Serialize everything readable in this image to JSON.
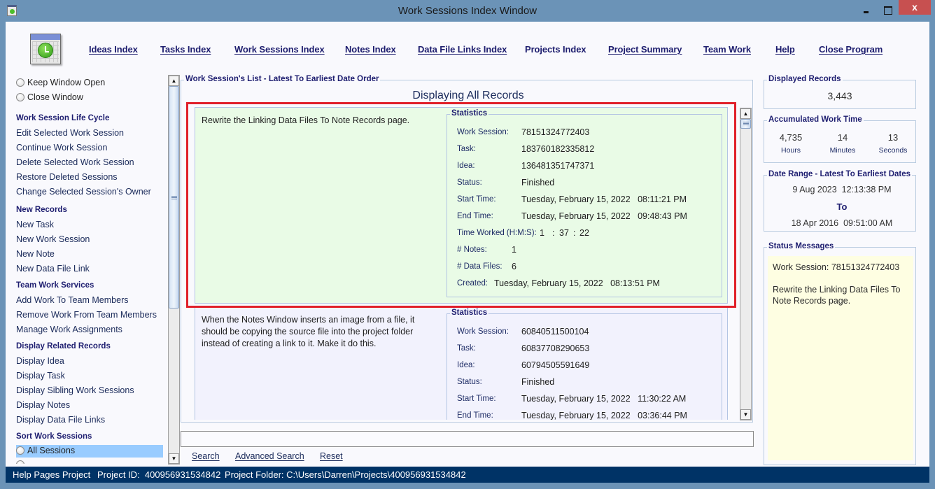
{
  "window": {
    "title": "Work Sessions Index Window",
    "close_glyph": "x"
  },
  "nav": {
    "items": [
      {
        "label": "Ideas Index"
      },
      {
        "label": "Tasks Index"
      },
      {
        "label": "Work Sessions Index"
      },
      {
        "label": "Notes Index"
      },
      {
        "label": "Data File Links Index"
      },
      {
        "label": "Projects Index"
      },
      {
        "label": "Project Summary"
      },
      {
        "label": "Team Work"
      },
      {
        "label": "Help"
      },
      {
        "label": "Close Program"
      }
    ]
  },
  "sidebar": {
    "window_options": [
      "Keep Window Open",
      "Close Window"
    ],
    "sections": [
      {
        "heading": "Work Session Life Cycle",
        "items": [
          "Edit Selected Work Session",
          "Continue Work Session",
          "Delete Selected Work Session",
          "Restore Deleted Sessions",
          "Change Selected Session's Owner"
        ]
      },
      {
        "heading": "New Records",
        "items": [
          "New Task",
          "New Work Session",
          "New Note",
          "New Data File Link"
        ]
      },
      {
        "heading": "Team Work Services",
        "items": [
          "Add Work To Team Members",
          "Remove Work From Team Members",
          "Manage Work Assignments"
        ]
      },
      {
        "heading": "Display Related Records",
        "items": [
          "Display Idea",
          "Display Task",
          "Display Sibling Work Sessions",
          "Display Notes",
          "Display Data File Links"
        ]
      },
      {
        "heading": "Sort Work Sessions",
        "items": [
          "All Sessions"
        ]
      }
    ],
    "sort_selected": "All Sessions"
  },
  "list": {
    "group_title": "Work Session's List - Latest To Earliest Date Order",
    "heading": "Displaying All Records",
    "stats_title": "Statistics",
    "labels": {
      "work_session": "Work Session:",
      "task": "Task:",
      "idea": "Idea:",
      "status": "Status:",
      "start_time": "Start Time:",
      "end_time": "End Time:",
      "time_worked": "Time Worked (H:M:S):",
      "notes": "# Notes:",
      "data_files": "# Data Files:",
      "created": "Created:"
    },
    "records": [
      {
        "description": "Rewrite the Linking Data Files To Note Records page.",
        "work_session": "78151324772403",
        "task": "183760182335812",
        "idea": "136481351747371",
        "status": "Finished",
        "start_time": "Tuesday, February 15, 2022   08:11:21 PM",
        "end_time": "Tuesday, February 15, 2022   09:48:43 PM",
        "time_worked": {
          "h": "1",
          "m": "37",
          "s": "22"
        },
        "notes": "1",
        "data_files": "6",
        "created": "Tuesday, February 15, 2022   08:13:51 PM",
        "selected": true,
        "bg": "#e9fbe6"
      },
      {
        "description": "When the Notes Window inserts an image from a file, it should be copying the source file into the project folder instead of creating a link to it. Make it do this.",
        "work_session": "60840511500104",
        "task": "60837708290653",
        "idea": "60794505591649",
        "status": "Finished",
        "start_time": "Tuesday, February 15, 2022   11:30:22 AM",
        "end_time": "Tuesday, February 15, 2022   03:36:44 PM",
        "selected": false,
        "bg": "#f2f2fd"
      }
    ]
  },
  "search": {
    "value": "",
    "search_label": "Search",
    "advanced_label": "Advanced Search",
    "reset_label": "Reset"
  },
  "right": {
    "displayed_records": {
      "title": "Displayed Records",
      "value": "3,443"
    },
    "accumulated": {
      "title": "Accumulated Work Time",
      "hours": "4,735",
      "hours_label": "Hours",
      "minutes": "14",
      "minutes_label": "Minutes",
      "seconds": "13",
      "seconds_label": "Seconds"
    },
    "date_range": {
      "title": "Date Range - Latest To Earliest Dates",
      "latest": "9 Aug 2023  12:13:38 PM",
      "to": "To",
      "earliest": "18 Apr 2016  09:51:00 AM"
    },
    "status": {
      "title": "Status Messages",
      "line1": "Work Session: 78151324772403",
      "line2": "Rewrite the Linking Data Files To Note Records page."
    }
  },
  "statusbar": {
    "project": "Help Pages Project",
    "project_id": "Project ID:  400956931534842",
    "project_folder": "Project Folder: C:\\Users\\Darren\\Projects\\400956931534842"
  },
  "colors": {
    "title_bar": "#6b93b7",
    "close_button": "#c75050",
    "selection_outline": "#e0202a",
    "status_bar": "#003366",
    "heading_text": "#1e1e70",
    "status_message_bg": "#fefee2",
    "sort_selected_bg": "#99ccff"
  }
}
